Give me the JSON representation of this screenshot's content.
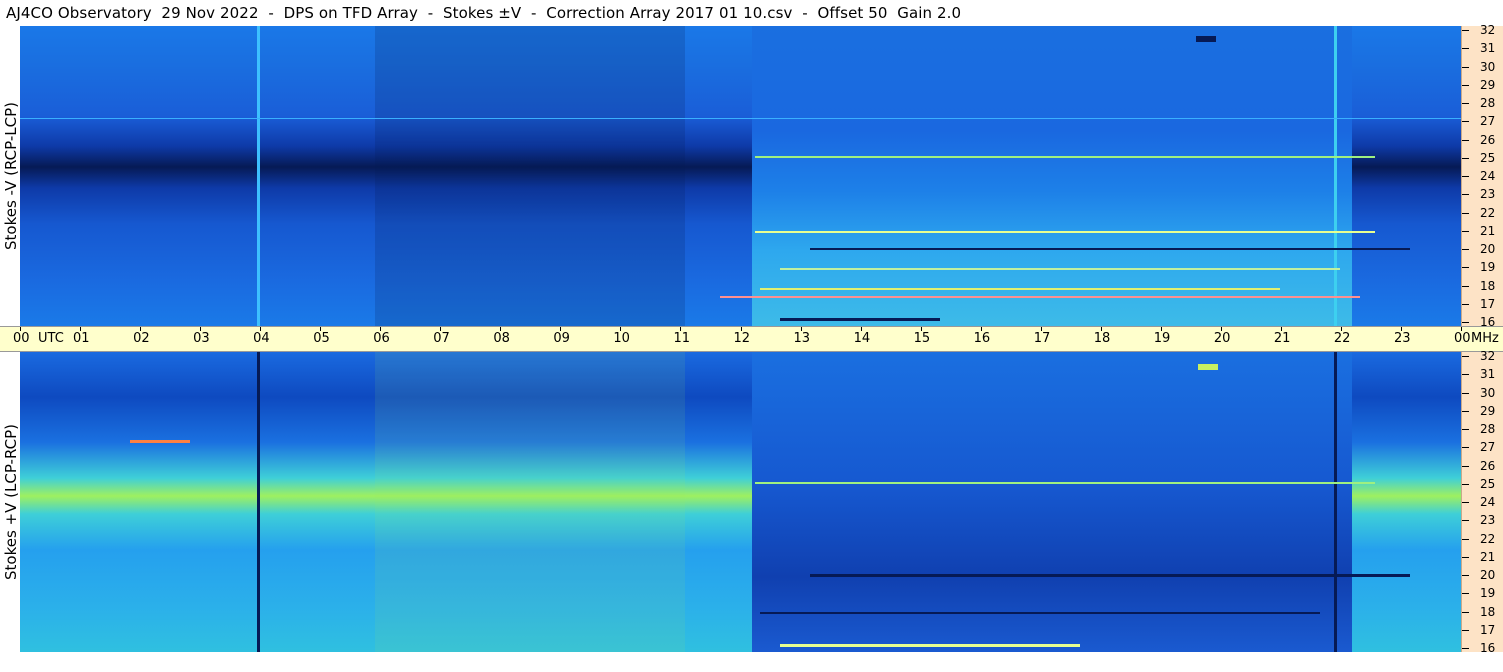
{
  "title": "AJ4CO Observatory  29 Nov 2022  -  DPS on TFD Array  -  Stokes ±V  -  Correction Array 2017 01 10.csv  -  Offset 50  Gain 2.0",
  "panels": {
    "top": {
      "label": "Stokes -V (RCP-LCP)"
    },
    "bottom": {
      "label": "Stokes +V (LCP-RCP)"
    }
  },
  "frequency_axis": {
    "unit": "MHz",
    "ticks": [
      "32",
      "31",
      "30",
      "29",
      "28",
      "27",
      "26",
      "25",
      "24",
      "23",
      "22",
      "21",
      "20",
      "19",
      "18",
      "17",
      "16"
    ]
  },
  "time_axis": {
    "unit": "UTC",
    "ticks": [
      "00",
      "01",
      "02",
      "03",
      "04",
      "05",
      "06",
      "07",
      "08",
      "09",
      "10",
      "11",
      "12",
      "13",
      "14",
      "15",
      "16",
      "17",
      "18",
      "19",
      "20",
      "21",
      "22",
      "23",
      "00"
    ]
  },
  "colors": {
    "spectrogram_dark": "#061a4e",
    "spectrogram_mid": "#1060e0",
    "spectrogram_light": "#2fb8f0",
    "spectrogram_bright": "#c8f060",
    "time_axis_bg": "#ffffcc",
    "freq_axis_bg": "#fde3c6"
  }
}
